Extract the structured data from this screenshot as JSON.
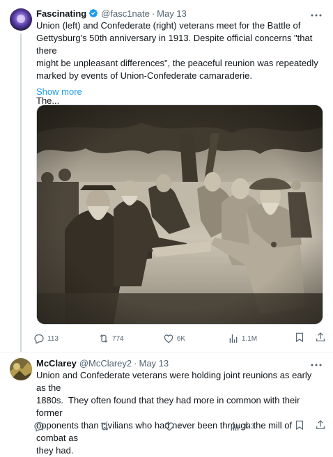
{
  "tweets": [
    {
      "author_name": "Fascinating",
      "handle": "@fasc1nate",
      "date": "May 13",
      "text": "Union (left) and Confederate (right) veterans meet for the Battle of\nGettysburg's 50th anniversary in 1913. Despite official concerns \"that there\nmight be unpleasant differences\", the peaceful reunion was repeatedly\nmarked by events of Union-Confederate camaraderie.\n\nThe...",
      "show_more": "Show more",
      "replies": "113",
      "reposts": "774",
      "likes": "6K",
      "views": "1.1M",
      "verified": true
    },
    {
      "author_name": "McClarey",
      "handle": "@McClarey2",
      "date": "May 13",
      "text": "Union and Confederate veterans were holding joint reunions as early as the\n1880s.  They often found that they had more in common with their former\nopponents than civilians who had never been through the mill of combat as\nthey had.",
      "replies": "",
      "reposts": "",
      "likes": "1",
      "views": "323"
    }
  ],
  "colors": {
    "accent": "#1d9bf0",
    "muted": "#536471",
    "text": "#0f1419"
  },
  "icons": [
    "reply-icon",
    "repost-icon",
    "like-icon",
    "views-icon",
    "bookmark-icon",
    "share-icon",
    "more-icon",
    "verified-icon"
  ]
}
